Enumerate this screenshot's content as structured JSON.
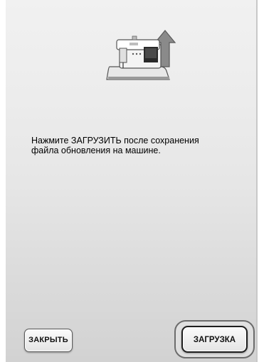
{
  "icons": {
    "machine_upload": "sewing-machine-upload-icon"
  },
  "message": {
    "line1": "Нажмите ЗАГРУЗИТЬ после сохранения",
    "line2": "файла обновления на машине."
  },
  "buttons": {
    "close_label": "ЗАКРЫТЬ",
    "load_label": "ЗАГРУЗКА"
  }
}
